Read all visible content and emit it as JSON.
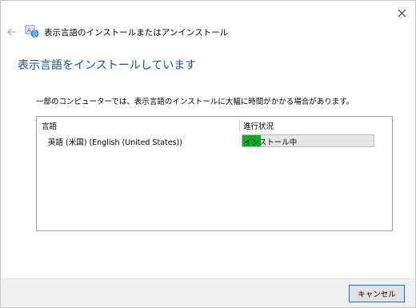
{
  "window": {
    "title": "表示言語のインストールまたはアンインストール"
  },
  "heading": "表示言語をインストールしています",
  "description": "一部のコンピューターでは、表示言語のインストールに大幅に時間がかかる場合があります。",
  "table": {
    "columns": [
      "言語",
      "進行状況"
    ],
    "rows": [
      {
        "language": "英語 (米国) (English (United States))",
        "status": "インストール中",
        "progress_fraction": 0.14
      }
    ]
  },
  "footer": {
    "cancel_label": "キャンセル"
  },
  "colors": {
    "heading": "#1c4fa0",
    "progress_fill": "#06b025",
    "button_border": "#0078d7"
  },
  "icons": [
    "close-icon",
    "back-arrow-icon",
    "language-globe-icon"
  ]
}
